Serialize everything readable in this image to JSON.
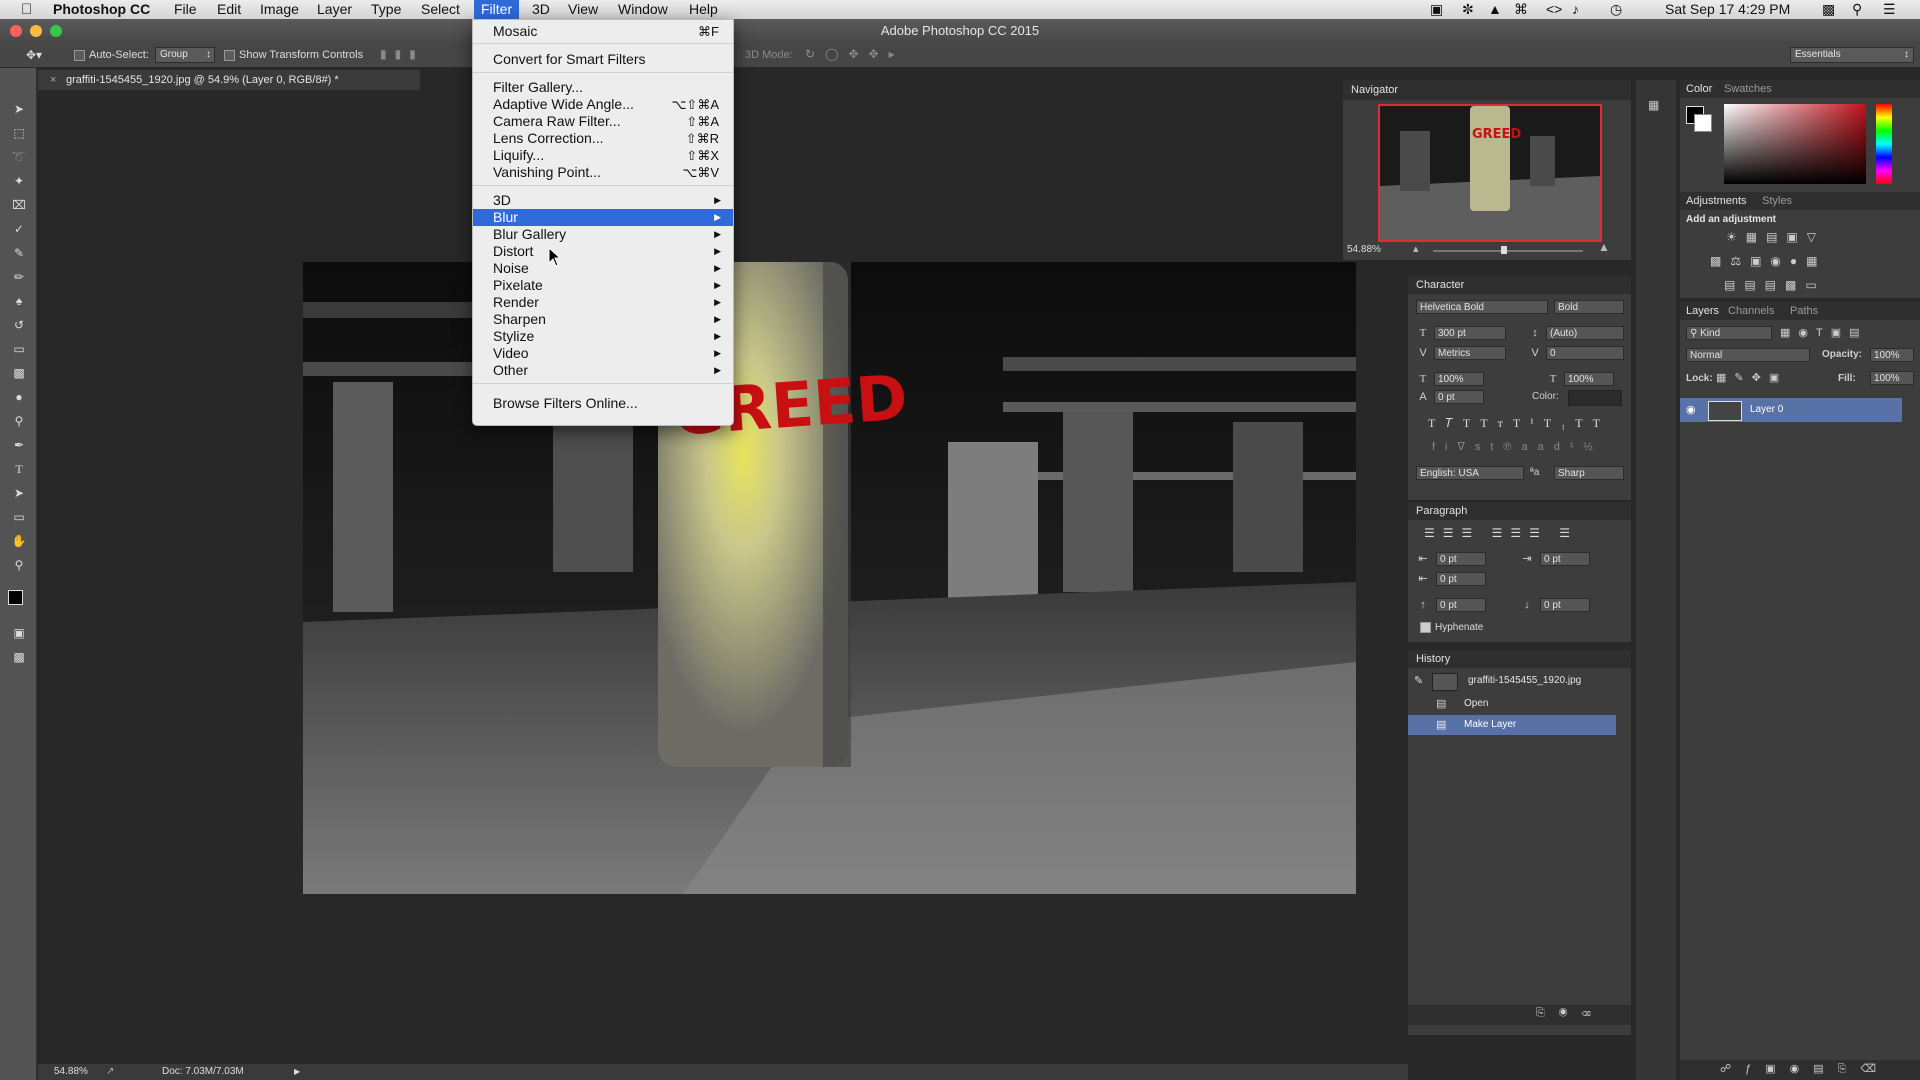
{
  "mac_menubar": {
    "apple": "",
    "app_name": "Photoshop CC",
    "menus": [
      "File",
      "Edit",
      "Image",
      "Layer",
      "Type",
      "Select",
      "Filter",
      "3D",
      "View",
      "Window",
      "Help"
    ],
    "active_menu": "Filter",
    "clock": "Sat Sep 17  4:29 PM"
  },
  "window": {
    "title": "Adobe Photoshop CC 2015"
  },
  "options_bar": {
    "auto_select_label": "Auto-Select:",
    "auto_select_value": "Group",
    "show_transform_label": "Show Transform Controls",
    "mode_3d_label": "3D Mode:",
    "workspace": "Essentials"
  },
  "document": {
    "tab_title": "graffiti-1545455_1920.jpg @ 54.9% (Layer 0, RGB/8#) *",
    "graffiti_text": "GREED",
    "zoom": "54.88%",
    "doc_size": "Doc: 7.03M/7.03M"
  },
  "filter_menu": {
    "items": [
      {
        "label": "Mosaic",
        "shortcut": "⌘F"
      },
      {
        "label": "Convert for Smart Filters",
        "shortcut": ""
      },
      {
        "label": "Filter Gallery...",
        "shortcut": ""
      },
      {
        "label": "Adaptive Wide Angle...",
        "shortcut": "⌥⇧⌘A"
      },
      {
        "label": "Camera Raw Filter...",
        "shortcut": "⇧⌘A"
      },
      {
        "label": "Lens Correction...",
        "shortcut": "⇧⌘R"
      },
      {
        "label": "Liquify...",
        "shortcut": "⇧⌘X"
      },
      {
        "label": "Vanishing Point...",
        "shortcut": "⌥⌘V"
      },
      {
        "label": "3D",
        "shortcut": ""
      },
      {
        "label": "Blur",
        "shortcut": ""
      },
      {
        "label": "Blur Gallery",
        "shortcut": ""
      },
      {
        "label": "Distort",
        "shortcut": ""
      },
      {
        "label": "Noise",
        "shortcut": ""
      },
      {
        "label": "Pixelate",
        "shortcut": ""
      },
      {
        "label": "Render",
        "shortcut": ""
      },
      {
        "label": "Sharpen",
        "shortcut": ""
      },
      {
        "label": "Stylize",
        "shortcut": ""
      },
      {
        "label": "Video",
        "shortcut": ""
      },
      {
        "label": "Other",
        "shortcut": ""
      },
      {
        "label": "Browse Filters Online...",
        "shortcut": ""
      }
    ],
    "highlighted": "Blur"
  },
  "navigator": {
    "title": "Navigator",
    "zoom": "54.88%"
  },
  "character": {
    "title": "Character",
    "font": "Helvetica Bold",
    "style": "Bold",
    "size": "300 pt",
    "leading": "(Auto)",
    "kerning": "Metrics",
    "tracking": "0",
    "vscale": "100%",
    "hscale": "100%",
    "baseline": "0 pt",
    "color_label": "Color:",
    "language": "English: USA",
    "aa": "Sharp",
    "aa_prefix": "ªa"
  },
  "paragraph": {
    "title": "Paragraph",
    "indent_left": "0 pt",
    "indent_right": "0 pt",
    "indent_first": "0 pt",
    "space_before": "0 pt",
    "space_after": "0 pt",
    "hyphenate": "Hyphenate"
  },
  "history": {
    "title": "History",
    "snapshot": "graffiti-1545455_1920.jpg",
    "items": [
      "Open",
      "Make Layer"
    ],
    "selected": "Make Layer"
  },
  "color_panel": {
    "tabs": [
      "Color",
      "Swatches"
    ],
    "accent": "#c0131c"
  },
  "adjustments": {
    "tabs": [
      "Adjustments",
      "Styles"
    ],
    "hint": "Add an adjustment"
  },
  "layers": {
    "tabs": [
      "Layers",
      "Channels",
      "Paths"
    ],
    "filter": "Kind",
    "blend": "Normal",
    "opacity_label": "Opacity:",
    "opacity": "100%",
    "lock_label": "Lock:",
    "fill_label": "Fill:",
    "fill": "100%",
    "layer_name": "Layer 0"
  }
}
